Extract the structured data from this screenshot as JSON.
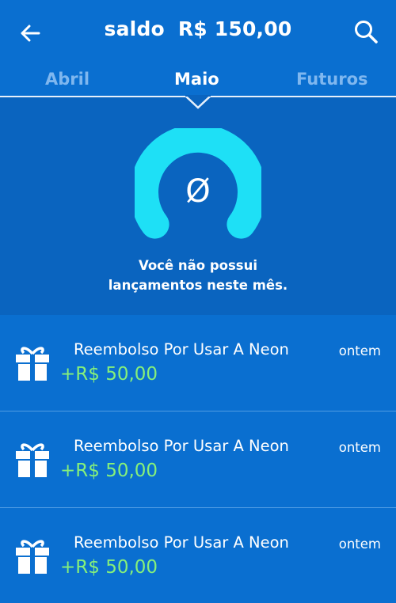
{
  "header": {
    "balance_label": "saldo",
    "balance_value": "R$ 150,00",
    "back_icon": "arrow-left-icon",
    "search_icon": "search-icon"
  },
  "tabs": [
    {
      "label": "Abril",
      "active": false
    },
    {
      "label": "Maio",
      "active": true
    },
    {
      "label": "Futuros",
      "active": false
    }
  ],
  "empty_state": {
    "icon": "empty-set-icon",
    "symbol": "Ø",
    "line1": "Você não possui",
    "line2": "lançamentos neste mês."
  },
  "transactions": [
    {
      "icon": "gift-icon",
      "title": "Reembolso Por Usar A Neon",
      "amount": "+R$ 50,00",
      "date": "ontem"
    },
    {
      "icon": "gift-icon",
      "title": "Reembolso Por Usar A Neon",
      "amount": "+R$ 50,00",
      "date": "ontem"
    },
    {
      "icon": "gift-icon",
      "title": "Reembolso Por Usar A Neon",
      "amount": "+R$ 50,00",
      "date": "ontem"
    }
  ],
  "colors": {
    "background": "#0a6fd0",
    "panel": "#0a64bf",
    "accent_cyan": "#1ee0f6",
    "amount_green": "#86f07a"
  }
}
